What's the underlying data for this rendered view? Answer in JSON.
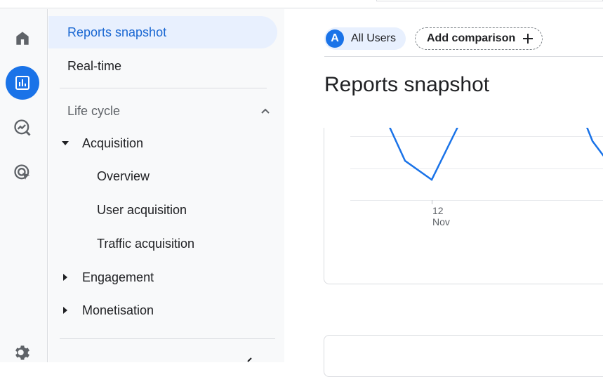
{
  "sidebar": {
    "items": [
      {
        "label": "Reports snapshot"
      },
      {
        "label": "Real-time"
      }
    ],
    "section": {
      "label": "Life cycle"
    },
    "tree": [
      {
        "label": "Acquisition"
      },
      {
        "label": "Engagement"
      },
      {
        "label": "Monetisation"
      }
    ],
    "acquisition_children": [
      {
        "label": "Overview"
      },
      {
        "label": "User acquisition"
      },
      {
        "label": "Traffic acquisition"
      }
    ]
  },
  "header": {
    "segment_initial": "A",
    "segment_label": "All Users",
    "add_comparison": "Add comparison",
    "title": "Reports snapshot"
  },
  "chart": {
    "x_tick_day": "12",
    "x_tick_month": "Nov"
  },
  "colors": {
    "accent": "#1a73e8",
    "selected_bg": "#e8f0fe",
    "line": "#1a73e8"
  }
}
